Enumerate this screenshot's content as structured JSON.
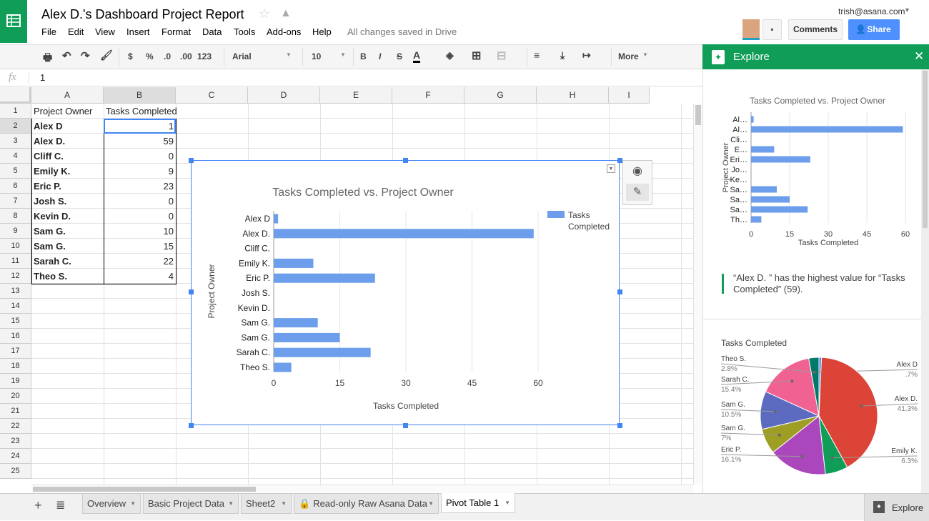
{
  "doc": {
    "title": "Alex D.'s Dashboard Project Report",
    "saved_status": "All changes saved in Drive"
  },
  "menu": [
    "File",
    "Edit",
    "View",
    "Insert",
    "Format",
    "Data",
    "Tools",
    "Add-ons",
    "Help"
  ],
  "account": {
    "email": "trish@asana.com",
    "comments_label": "Comments",
    "share_label": "Share"
  },
  "toolbar": {
    "currency": "$",
    "percent": "%",
    "dec_less": ".0",
    "dec_more": ".00",
    "format": "123",
    "font": "Arial",
    "size": "10",
    "bold": "B",
    "italic": "I",
    "strike": "S",
    "text_color": "A",
    "more": "More"
  },
  "formula": {
    "fx": "fx",
    "value": "1"
  },
  "columns": [
    "A",
    "B",
    "C",
    "D",
    "E",
    "F",
    "G",
    "H",
    "I"
  ],
  "rows": [
    "1",
    "2",
    "3",
    "4",
    "5",
    "6",
    "7",
    "8",
    "9",
    "10",
    "11",
    "12",
    "13",
    "14",
    "15",
    "16",
    "17",
    "18",
    "19",
    "20",
    "21",
    "22",
    "23",
    "24",
    "25"
  ],
  "table": {
    "headers": [
      "Project Owner",
      "Tasks Completed"
    ],
    "data": [
      [
        "Alex D",
        "1"
      ],
      [
        "Alex D.",
        "59"
      ],
      [
        "Cliff C.",
        "0"
      ],
      [
        "Emily K.",
        "9"
      ],
      [
        "Eric P.",
        "23"
      ],
      [
        "Josh S.",
        "0"
      ],
      [
        "Kevin D.",
        "0"
      ],
      [
        "Sam G.",
        "10"
      ],
      [
        "Sam G.",
        "15"
      ],
      [
        "Sarah C.",
        "22"
      ],
      [
        "Theo S.",
        "4"
      ]
    ]
  },
  "chart_data": [
    {
      "type": "bar",
      "orientation": "horizontal",
      "title": "Tasks Completed vs. Project Owner",
      "xlabel": "Tasks Completed",
      "ylabel": "Project Owner",
      "categories": [
        "Alex D",
        "Alex D.",
        "Cliff C.",
        "Emily K.",
        "Eric P.",
        "Josh S.",
        "Kevin D.",
        "Sam G.",
        "Sam G.",
        "Sarah C.",
        "Theo S."
      ],
      "series": [
        {
          "name": "Tasks Completed",
          "values": [
            1,
            59,
            0,
            9,
            23,
            0,
            0,
            10,
            15,
            22,
            4
          ]
        }
      ],
      "xlim": [
        0,
        60
      ],
      "ticks": [
        "0",
        "15",
        "30",
        "45",
        "60"
      ],
      "grid": true,
      "legend": "right",
      "color": "#6d9eeb"
    },
    {
      "type": "bar",
      "orientation": "horizontal",
      "title": "Tasks Completed vs. Project Owner",
      "xlabel": "Tasks Completed",
      "ylabel": "Project Owner",
      "categories": [
        "Al…",
        "Al…",
        "Cli…",
        "E…",
        "Eri…",
        "Jo…",
        "Ke…",
        "Sa…",
        "Sa…",
        "Sa…",
        "Th…"
      ],
      "values": [
        1,
        59,
        0,
        9,
        23,
        0,
        0,
        10,
        15,
        22,
        4
      ],
      "xlim": [
        0,
        60
      ],
      "ticks": [
        "0",
        "15",
        "30",
        "45",
        "60"
      ],
      "grid": true,
      "color": "#6d9eeb"
    },
    {
      "type": "pie",
      "title": "Tasks Completed",
      "slices": [
        {
          "label": "Alex D",
          "value": 1,
          "pct": ".7%",
          "color": "#4285f4"
        },
        {
          "label": "Alex D.",
          "value": 59,
          "pct": "41.3%",
          "color": "#db4437"
        },
        {
          "label": "Emily K.",
          "value": 9,
          "pct": "6.3%",
          "color": "#0f9d58"
        },
        {
          "label": "Eric P.",
          "value": 23,
          "pct": "16.1%",
          "color": "#ab47bc"
        },
        {
          "label": "Sam G.",
          "value": 10,
          "pct": "7%",
          "color": "#9e9d24"
        },
        {
          "label": "Sam G.",
          "value": 15,
          "pct": "10.5%",
          "color": "#5c6bc0"
        },
        {
          "label": "Sarah C.",
          "value": 22,
          "pct": "15.4%",
          "color": "#f06292"
        },
        {
          "label": "Theo S.",
          "value": 4,
          "pct": "2.8%",
          "color": "#00796b"
        }
      ]
    }
  ],
  "explore": {
    "title": "Explore",
    "insight": "“Alex D. ” has the highest value for “Tasks Completed” (59)."
  },
  "sheets": [
    "Overview",
    "Basic Project Data",
    "Sheet2",
    "Read-only Raw Asana Data",
    "Pivot Table 1"
  ],
  "active_sheet": "Pivot Table 1",
  "explore_button": "Explore",
  "colors": {
    "brand": "#0f9d58",
    "accent": "#4285f4"
  }
}
